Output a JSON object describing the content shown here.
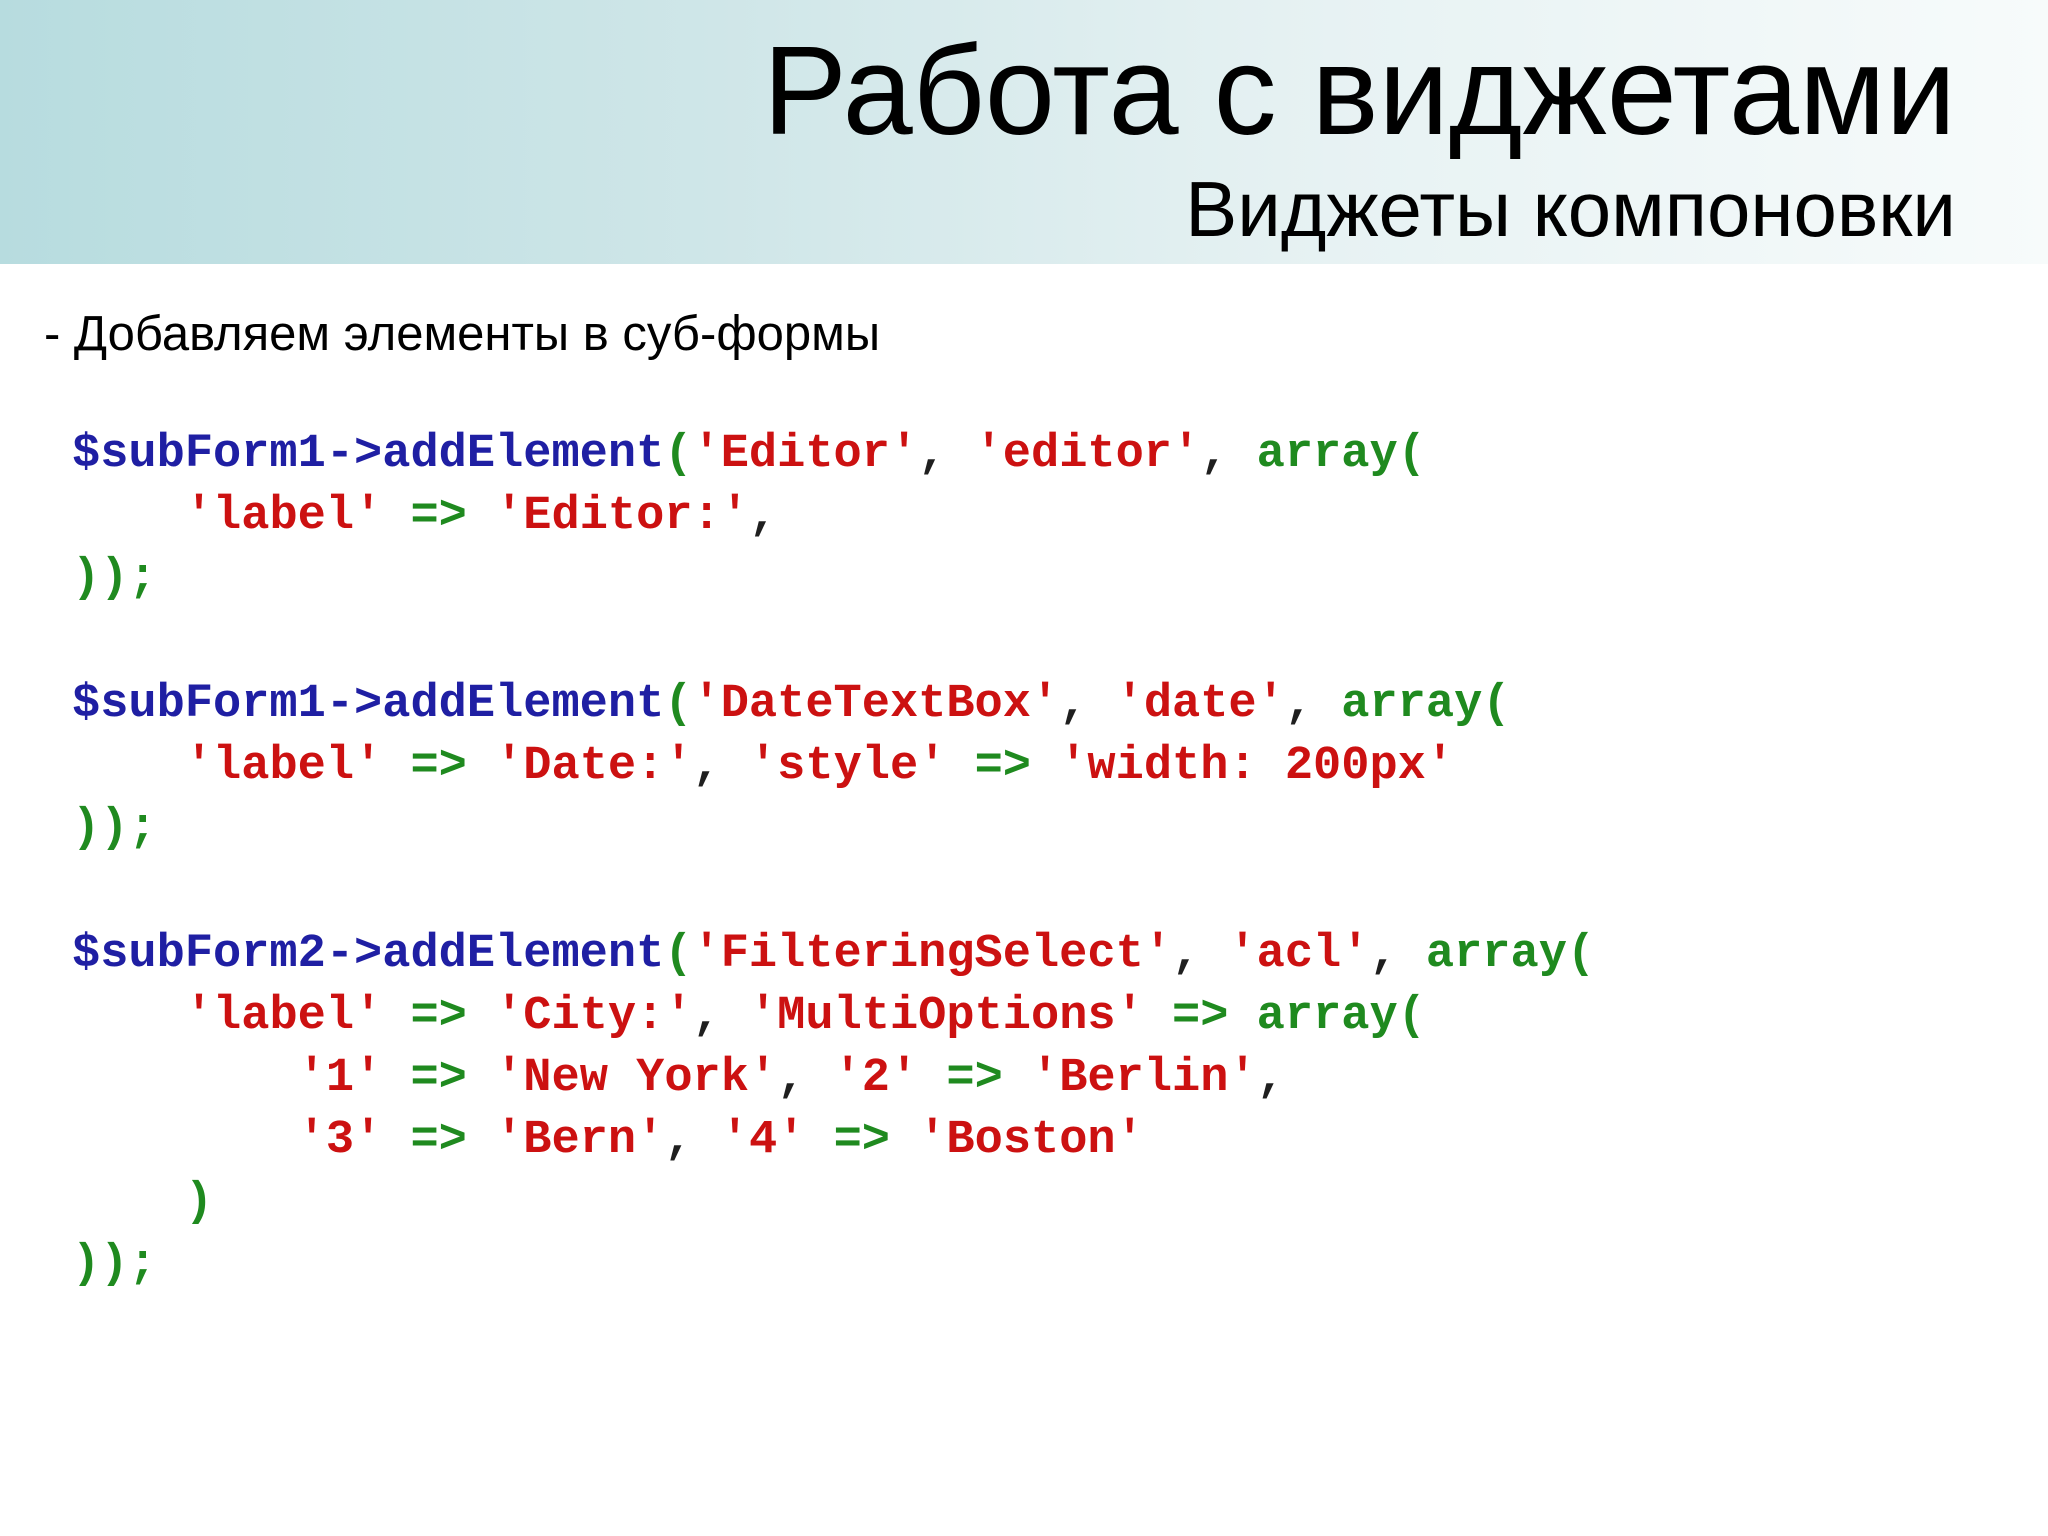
{
  "slide": {
    "title": "Работа с виджетами",
    "subtitle": "Виджеты компоновки",
    "bullet": "- Добавляем элементы в суб-формы"
  },
  "colors": {
    "header_gradient_start": "#b7dcdf",
    "header_gradient_end": "#f7fbfb",
    "variable": "#1f1fa3",
    "string": "#cc1111",
    "operator": "#1f8a1f",
    "punctuation": "#1f1f1f"
  },
  "code": {
    "block1": {
      "line1": {
        "var": "$subForm1->addElement",
        "paren": "(",
        "s1": "'Editor'",
        "c1": ", ",
        "s2": "'editor'",
        "c2": ", ",
        "kw": "array("
      },
      "line2": {
        "indent": "    ",
        "s1": "'label'",
        "op": " => ",
        "s2": "'Editor:'",
        "c1": ","
      },
      "line3": {
        "close": "));"
      }
    },
    "block2": {
      "line1": {
        "var": "$subForm1->addElement",
        "paren": "(",
        "s1": "'DateTextBox'",
        "c1": ", ",
        "s2": "'date'",
        "c2": ", ",
        "kw": "array("
      },
      "line2": {
        "indent": "    ",
        "s1": "'label'",
        "op1": " => ",
        "s2": "'Date:'",
        "c1": ", ",
        "s3": "'style'",
        "op2": " => ",
        "s4": "'width: 200px'"
      },
      "line3": {
        "close": "));"
      }
    },
    "block3": {
      "line1": {
        "var": "$subForm2->addElement",
        "paren": "(",
        "s1": "'FilteringSelect'",
        "c1": ", ",
        "s2": "'acl'",
        "c2": ", ",
        "kw": "array("
      },
      "line2": {
        "indent": "    ",
        "s1": "'label'",
        "op1": " => ",
        "s2": "'City:'",
        "c1": ", ",
        "s3": "'MultiOptions'",
        "op2": " => ",
        "kw": "array("
      },
      "line3": {
        "indent": "        ",
        "s1": "'1'",
        "op1": " => ",
        "s2": "'New York'",
        "c1": ", ",
        "s3": "'2'",
        "op2": " => ",
        "s4": "'Berlin'",
        "c2": ","
      },
      "line4": {
        "indent": "        ",
        "s1": "'3'",
        "op1": " => ",
        "s2": "'Bern'",
        "c1": ", ",
        "s3": "'4'",
        "op2": " => ",
        "s4": "'Boston'"
      },
      "line5": {
        "indent": "    ",
        "close": ")"
      },
      "line6": {
        "close": "));"
      }
    }
  }
}
